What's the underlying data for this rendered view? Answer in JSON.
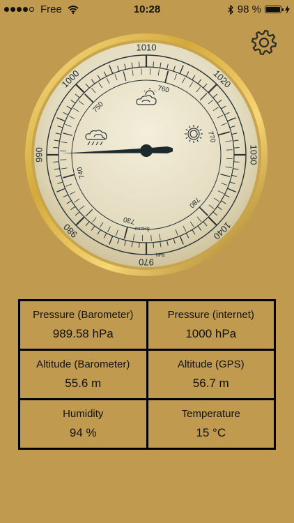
{
  "status_bar": {
    "carrier": "Free",
    "time": "10:28",
    "battery_text": "98 %",
    "battery_level": 0.98,
    "signal_bars_filled": 4,
    "signal_bars_total": 5
  },
  "gauge": {
    "hpa_labels": [
      "970",
      "980",
      "990",
      "1000",
      "1010",
      "1020",
      "1030",
      "1040"
    ],
    "hpa_unit": "hPa",
    "mmhg_labels": [
      "730",
      "740",
      "750",
      "760",
      "770",
      "780"
    ],
    "mmhg_unit": "mmHg",
    "pointer_hpa": 989.58,
    "colors": {
      "rim": "#d4a93a",
      "face": "#e7dfc5",
      "ink": "#1c2a2e"
    }
  },
  "readings": [
    {
      "label": "Pressure (Barometer)",
      "value": "989.58 hPa"
    },
    {
      "label": "Pressure (internet)",
      "value": "1000 hPa"
    },
    {
      "label": "Altitude (Barometer)",
      "value": "55.6 m"
    },
    {
      "label": "Altitude (GPS)",
      "value": "56.7 m"
    },
    {
      "label": "Humidity",
      "value": "94 %"
    },
    {
      "label": "Temperature",
      "value": "15 °C"
    }
  ]
}
